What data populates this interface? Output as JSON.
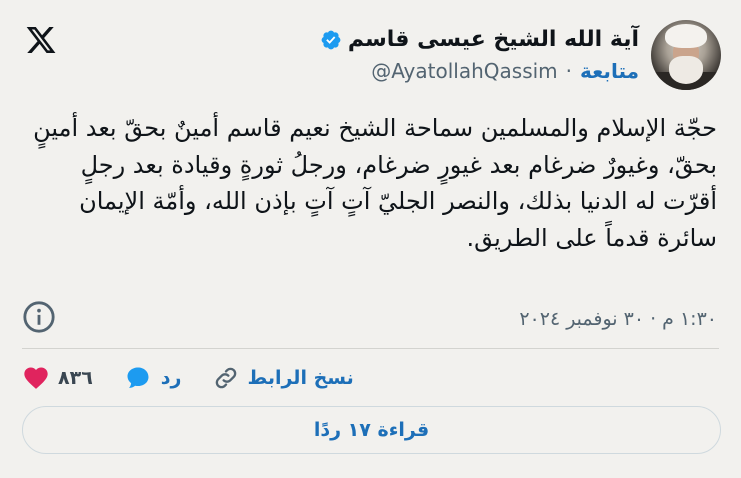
{
  "author": {
    "name": "آية الله الشيخ عيسى قاسم",
    "handle": "@AyatollahQassim",
    "separator": "·",
    "follow_label": "متابعة"
  },
  "tweet": {
    "text": "حجّة الإسلام والمسلمين سماحة الشيخ نعيم قاسم أمينٌ بحقّ بعد أمينٍ بحقّ، وغيورٌ ضرغام بعد غيورٍ ضرغام، ورجلُ ثورةٍ وقيادة بعد رجلٍ أقرّت له الدنيا بذلك، والنصر الجليّ آتٍ آتٍ بإذن الله، وأمّة الإيمان سائرة قدماً على الطريق.",
    "timestamp": "١:٣٠ م · ٣٠ نوفمبر ٢٠٢٤"
  },
  "actions": {
    "likes_count": "٨٣٦",
    "reply_label": "رد",
    "copy_link_label": "نسخ الرابط"
  },
  "read_replies_label": "قراءة ١٧ ردًا",
  "colors": {
    "accent": "#1d6fb8",
    "like": "#e0245e",
    "verified": "#1d9bf0",
    "background": "#f2f1ee"
  },
  "icons": [
    "x-logo-icon",
    "verified-badge-icon",
    "info-icon",
    "heart-icon",
    "reply-bubble-icon",
    "link-icon"
  ]
}
